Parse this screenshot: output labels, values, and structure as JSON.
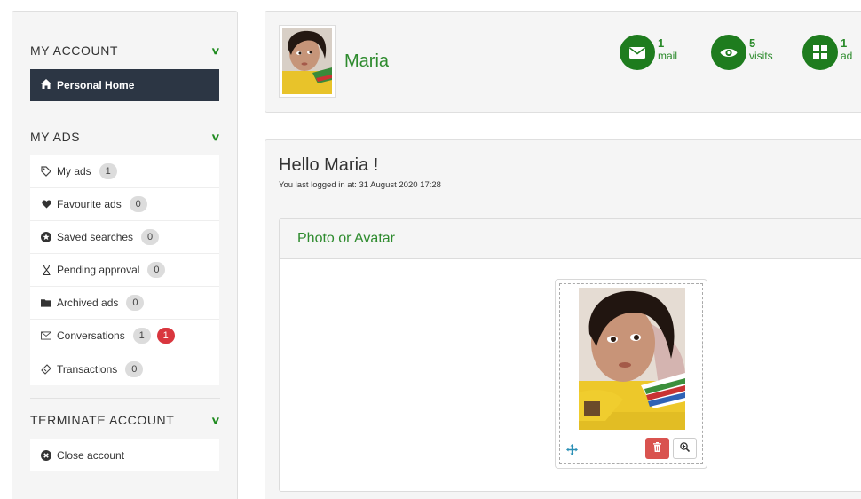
{
  "sidebar": {
    "my_account": {
      "title": "MY ACCOUNT",
      "active_item": {
        "label": "Personal Home",
        "icon": "home-icon"
      }
    },
    "my_ads": {
      "title": "MY ADS",
      "items": [
        {
          "label": "My ads",
          "icon": "tags-icon",
          "count": "1"
        },
        {
          "label": "Favourite ads",
          "icon": "heart-icon",
          "count": "0"
        },
        {
          "label": "Saved searches",
          "icon": "star-circle-icon",
          "count": "0"
        },
        {
          "label": "Pending approval",
          "icon": "hourglass-icon",
          "count": "0"
        },
        {
          "label": "Archived ads",
          "icon": "folder-icon",
          "count": "0"
        },
        {
          "label": "Conversations",
          "icon": "envelope-icon",
          "count": "1",
          "unread": "1"
        },
        {
          "label": "Transactions",
          "icon": "ticket-icon",
          "count": "0"
        }
      ]
    },
    "terminate": {
      "title": "TERMINATE ACCOUNT",
      "items": [
        {
          "label": "Close account",
          "icon": "times-circle-icon"
        }
      ]
    }
  },
  "profile": {
    "name": "Maria",
    "stats": [
      {
        "value": "1",
        "label": "mail",
        "icon": "envelope-icon"
      },
      {
        "value": "5",
        "label": "visits",
        "icon": "eye-icon"
      },
      {
        "value": "1",
        "label": "ad",
        "icon": "grid-icon"
      }
    ]
  },
  "main": {
    "greeting": "Hello Maria !",
    "last_login": "You last logged in at: 31 August 2020 17:28",
    "photo_panel": {
      "title": "Photo or Avatar"
    }
  },
  "colors": {
    "accent_green": "#2e8b2e",
    "stat_circle": "#1e7c1e",
    "active_bg": "#2c3644",
    "danger": "#d9534f",
    "badge_red": "#d9363e"
  }
}
